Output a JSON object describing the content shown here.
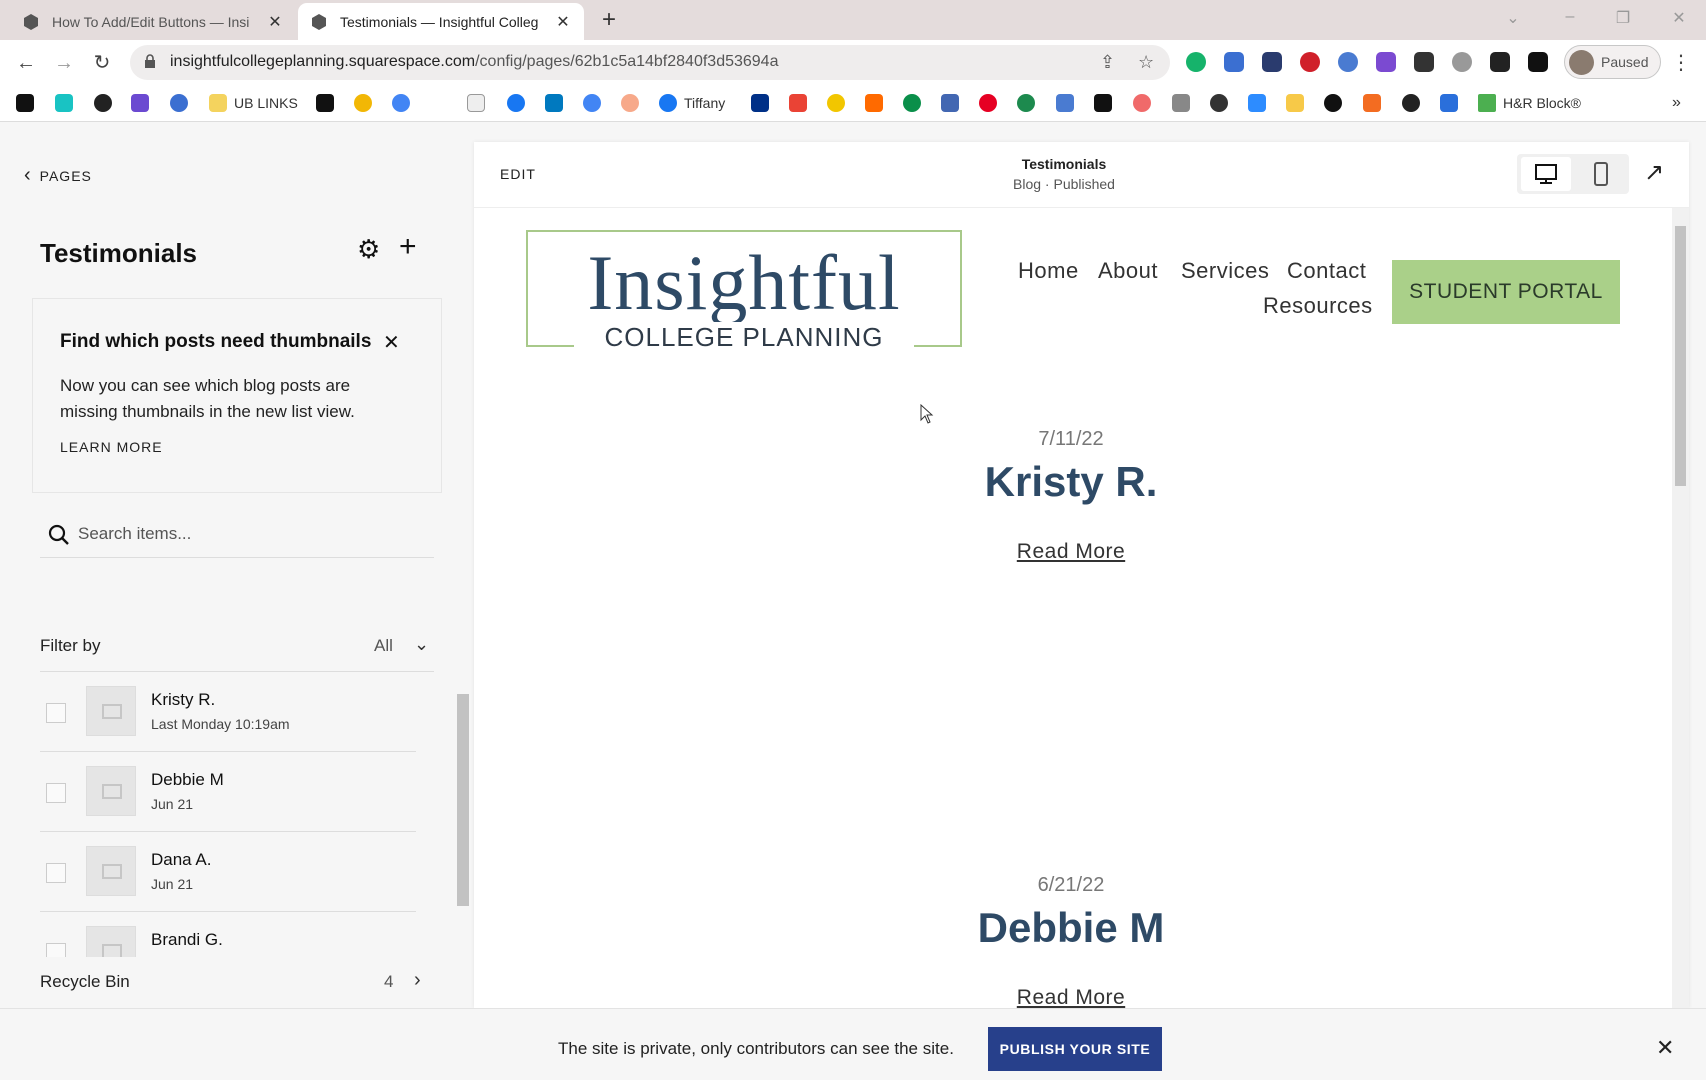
{
  "browser": {
    "tabs": [
      {
        "title": "How To Add/Edit Buttons — Insi",
        "active": false
      },
      {
        "title": "Testimonials — Insightful Colleg",
        "active": true
      }
    ],
    "url": "insightfulcollegeplanning.squarespace.com",
    "url_path": "/config/pages/62b1c5a14bf2840f3d53694a",
    "profile_status": "Paused",
    "bookmarks": [
      {
        "label": "UB LINKS"
      },
      {
        "label": "Tiffany"
      },
      {
        "label": "H&R Block®"
      }
    ],
    "colors": {
      "tabbar": "#e4dcdc",
      "accent_red": "#c2185b"
    }
  },
  "sidebar": {
    "back_label": "PAGES",
    "title": "Testimonials",
    "notice": {
      "heading": "Find which posts need thumbnails",
      "body": "Now you can see which blog posts are missing thumbnails in the new list view.",
      "link": "LEARN MORE"
    },
    "search_placeholder": "Search items...",
    "filter_label": "Filter by",
    "filter_value": "All",
    "posts": [
      {
        "name": "Kristy R.",
        "date": "Last Monday 10:19am"
      },
      {
        "name": "Debbie M",
        "date": "Jun 21"
      },
      {
        "name": "Dana A.",
        "date": "Jun 21"
      },
      {
        "name": "Brandi G.",
        "date": ""
      }
    ],
    "recycle_label": "Recycle Bin",
    "recycle_count": "4"
  },
  "preview": {
    "edit_label": "EDIT",
    "page_title": "Testimonials",
    "page_subtitle": "Blog · Published",
    "site": {
      "logo_main": "Insightful",
      "logo_sub": "COLLEGE PLANNING",
      "nav": [
        "Home",
        "About",
        "Services",
        "Contact",
        "Resources"
      ],
      "cta": "STUDENT PORTAL",
      "entries": [
        {
          "date": "7/11/22",
          "title": "Kristy R.",
          "link": "Read More"
        },
        {
          "date": "6/21/22",
          "title": "Debbie M",
          "link": "Read More"
        }
      ],
      "colors": {
        "brand_blue": "#2e4a66",
        "cta_green": "#aad089"
      }
    }
  },
  "footer": {
    "message": "The site is private, only contributors can see the site.",
    "publish_label": "PUBLISH YOUR SITE",
    "publish_color": "#27408b"
  }
}
